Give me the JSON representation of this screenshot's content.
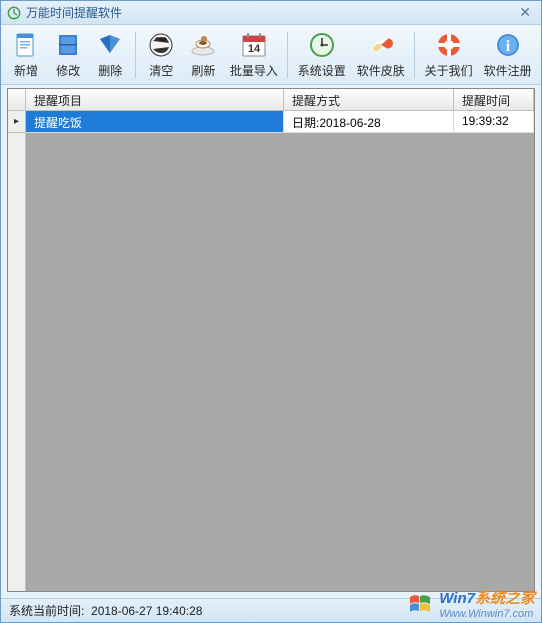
{
  "window": {
    "title": "万能时间提醒软件"
  },
  "toolbar": {
    "items": [
      {
        "key": "new",
        "label": "新增"
      },
      {
        "key": "edit",
        "label": "修改"
      },
      {
        "key": "delete",
        "label": "删除"
      },
      {
        "key": "clear",
        "label": "清空"
      },
      {
        "key": "refresh",
        "label": "刷新"
      },
      {
        "key": "batchimport",
        "label": "批量导入"
      },
      {
        "key": "settings",
        "label": "系统设置"
      },
      {
        "key": "skin",
        "label": "软件皮肤"
      },
      {
        "key": "about",
        "label": "关于我们"
      },
      {
        "key": "register",
        "label": "软件注册"
      }
    ]
  },
  "table": {
    "columns": [
      "提醒项目",
      "提醒方式",
      "提醒时间"
    ],
    "rows": [
      {
        "project": "提醒吃饭",
        "method": "日期:2018-06-28",
        "time": "19:39:32",
        "selected": true
      }
    ]
  },
  "statusbar": {
    "label": "系统当前时间:",
    "value": "2018-06-27 19:40:28"
  },
  "watermark": {
    "text1": "Win7",
    "text2": "系统之家",
    "url": "Www.Winwin7.com"
  }
}
